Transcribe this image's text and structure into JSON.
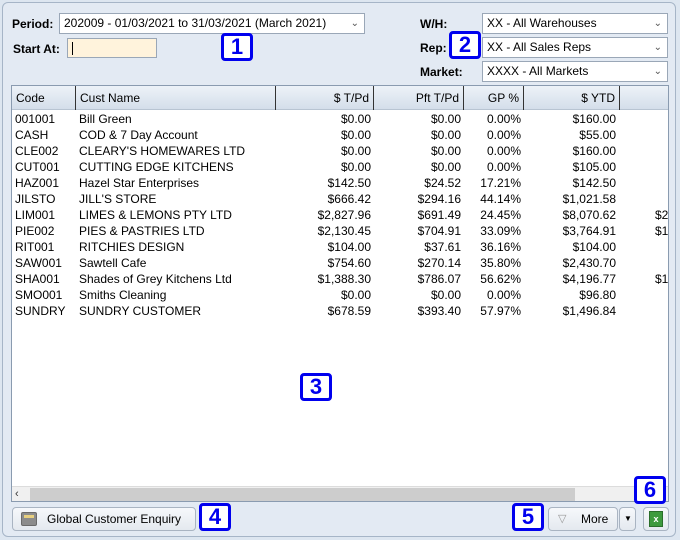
{
  "filters": {
    "period_label": "Period:",
    "period_value": "202009 - 01/03/2021 to 31/03/2021 (March 2021)",
    "start_at_label": "Start At:",
    "start_at_value": "",
    "wh_label": "W/H:",
    "wh_value": "XX - All Warehouses",
    "rep_label": "Rep:",
    "rep_value": "XX - All Sales Reps",
    "market_label": "Market:",
    "market_value": "XXXX - All Markets"
  },
  "badges": [
    "1",
    "2",
    "3",
    "4",
    "5",
    "6"
  ],
  "table": {
    "columns": [
      "Code",
      "Cust Name",
      "$ T/Pd",
      "Pft T/Pd",
      "GP %",
      "$ YTD",
      ""
    ],
    "rows": [
      {
        "code": "001001",
        "name": "Bill Green",
        "tpd": "$0.00",
        "pft": "$0.00",
        "gp": "0.00%",
        "ytd": "$160.00",
        "extra": ""
      },
      {
        "code": "CASH",
        "name": "COD & 7 Day Account",
        "tpd": "$0.00",
        "pft": "$0.00",
        "gp": "0.00%",
        "ytd": "$55.00",
        "extra": ""
      },
      {
        "code": "CLE002",
        "name": "CLEARY'S HOMEWARES LTD",
        "tpd": "$0.00",
        "pft": "$0.00",
        "gp": "0.00%",
        "ytd": "$160.00",
        "extra": ""
      },
      {
        "code": "CUT001",
        "name": "CUTTING EDGE KITCHENS",
        "tpd": "$0.00",
        "pft": "$0.00",
        "gp": "0.00%",
        "ytd": "$105.00",
        "extra": ""
      },
      {
        "code": "HAZ001",
        "name": "Hazel Star Enterprises",
        "tpd": "$142.50",
        "pft": "$24.52",
        "gp": "17.21%",
        "ytd": "$142.50",
        "extra": ""
      },
      {
        "code": "JILSTO",
        "name": "JILL'S STORE",
        "tpd": "$666.42",
        "pft": "$294.16",
        "gp": "44.14%",
        "ytd": "$1,021.58",
        "extra": ""
      },
      {
        "code": "LIM001",
        "name": "LIMES & LEMONS PTY LTD",
        "tpd": "$2,827.96",
        "pft": "$691.49",
        "gp": "24.45%",
        "ytd": "$8,070.62",
        "extra": "$2"
      },
      {
        "code": "PIE002",
        "name": "PIES & PASTRIES LTD",
        "tpd": "$2,130.45",
        "pft": "$704.91",
        "gp": "33.09%",
        "ytd": "$3,764.91",
        "extra": "$1"
      },
      {
        "code": "RIT001",
        "name": "RITCHIES DESIGN",
        "tpd": "$104.00",
        "pft": "$37.61",
        "gp": "36.16%",
        "ytd": "$104.00",
        "extra": ""
      },
      {
        "code": "SAW001",
        "name": "Sawtell Cafe",
        "tpd": "$754.60",
        "pft": "$270.14",
        "gp": "35.80%",
        "ytd": "$2,430.70",
        "extra": ""
      },
      {
        "code": "SHA001",
        "name": "Shades of Grey Kitchens Ltd",
        "tpd": "$1,388.30",
        "pft": "$786.07",
        "gp": "56.62%",
        "ytd": "$4,196.77",
        "extra": "$1"
      },
      {
        "code": "SMO001",
        "name": "Smiths Cleaning",
        "tpd": "$0.00",
        "pft": "$0.00",
        "gp": "0.00%",
        "ytd": "$96.80",
        "extra": ""
      },
      {
        "code": "SUNDRY",
        "name": "SUNDRY CUSTOMER",
        "tpd": "$678.59",
        "pft": "$393.40",
        "gp": "57.97%",
        "ytd": "$1,496.84",
        "extra": ""
      }
    ]
  },
  "buttons": {
    "global_customer_enquiry": "Global Customer Enquiry",
    "more": "More"
  },
  "icons": {
    "dropdown": "chevron-down-icon",
    "gce": "cabinet-icon",
    "export": "excel-icon"
  }
}
